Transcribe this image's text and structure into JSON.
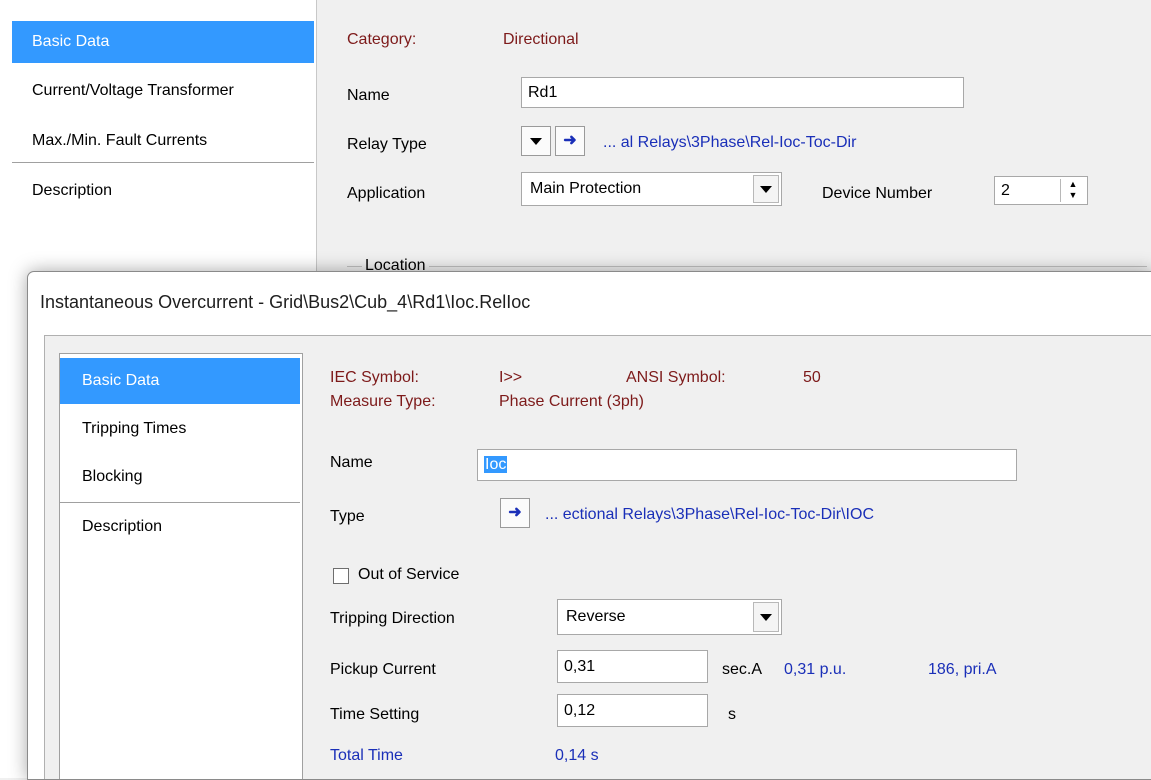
{
  "main": {
    "sidebar": {
      "items": [
        {
          "label": "Basic Data",
          "selected": true
        },
        {
          "label": "Current/Voltage Transformer"
        },
        {
          "label": "Max./Min. Fault Currents"
        },
        {
          "label": "Description"
        }
      ]
    },
    "category_label": "Category:",
    "category_value": "Directional",
    "name_label": "Name",
    "name_value": "Rd1",
    "relay_type_label": "Relay Type",
    "relay_type_path": "... al Relays\\3Phase\\Rel-Ioc-Toc-Dir",
    "application_label": "Application",
    "application_value": "Main Protection",
    "device_number_label": "Device Number",
    "device_number_value": "2",
    "location_label": "Location"
  },
  "dialog": {
    "title": "Instantaneous Overcurrent - Grid\\Bus2\\Cub_4\\Rd1\\Ioc.RelIoc",
    "sidebar": {
      "items": [
        {
          "label": "Basic Data",
          "selected": true
        },
        {
          "label": "Tripping Times"
        },
        {
          "label": "Blocking"
        },
        {
          "label": "Description"
        }
      ]
    },
    "iec_symbol_label": "IEC Symbol:",
    "iec_symbol_value": "I>>",
    "ansi_symbol_label": "ANSI Symbol:",
    "ansi_symbol_value": "50",
    "measure_type_label": "Measure Type:",
    "measure_type_value": "Phase Current (3ph)",
    "name_label": "Name",
    "name_value": "Ioc",
    "type_label": "Type",
    "type_path": "... ectional Relays\\3Phase\\Rel-Ioc-Toc-Dir\\IOC",
    "out_of_service_label": "Out of Service",
    "out_of_service_checked": false,
    "tripping_direction_label": "Tripping Direction",
    "tripping_direction_value": "Reverse",
    "pickup_current_label": "Pickup Current",
    "pickup_current_value": "0,31",
    "pickup_unit": "sec.A",
    "pickup_pu": "0,31 p.u.",
    "pickup_pri": "186, pri.A",
    "time_setting_label": "Time Setting",
    "time_setting_value": "0,12",
    "time_setting_unit": "s",
    "total_time_label": "Total Time",
    "total_time_value": "0,14 s"
  },
  "colors": {
    "selection": "#3399ff",
    "label_red": "#7d1a1a",
    "link_blue": "#1a2fb8"
  }
}
